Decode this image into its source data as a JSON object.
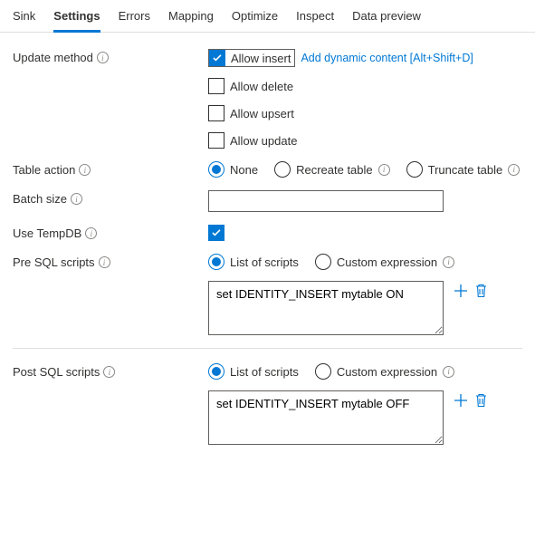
{
  "tabs": {
    "sink": "Sink",
    "settings": "Settings",
    "errors": "Errors",
    "mapping": "Mapping",
    "optimize": "Optimize",
    "inspect": "Inspect",
    "data_preview": "Data preview"
  },
  "labels": {
    "update_method": "Update method",
    "table_action": "Table action",
    "batch_size": "Batch size",
    "use_tempdb": "Use TempDB",
    "pre_sql": "Pre SQL scripts",
    "post_sql": "Post SQL scripts"
  },
  "update_method": {
    "allow_insert": "Allow insert",
    "allow_delete": "Allow delete",
    "allow_upsert": "Allow upsert",
    "allow_update": "Allow update",
    "dynamic_link": "Add dynamic content [Alt+Shift+D]"
  },
  "table_action": {
    "none": "None",
    "recreate": "Recreate table",
    "truncate": "Truncate table"
  },
  "batch_size": {
    "value": ""
  },
  "scripts_mode": {
    "list": "List of scripts",
    "custom": "Custom expression"
  },
  "pre_sql": {
    "value": "set IDENTITY_INSERT mytable ON"
  },
  "post_sql": {
    "value": "set IDENTITY_INSERT mytable OFF"
  },
  "info_glyph": "i"
}
